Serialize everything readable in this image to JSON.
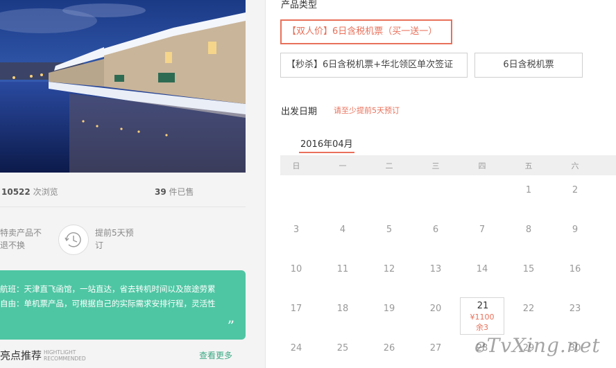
{
  "left": {
    "stats": {
      "views_count": "10522",
      "views_label": "次浏览",
      "sold_count": "39",
      "sold_label": "件已售"
    },
    "features": [
      {
        "line1": "特卖产品不",
        "line2": "退不换"
      },
      {
        "line1": "提前5天预",
        "line2": "订"
      }
    ],
    "highlight": {
      "line1": "航班：天津直飞函馆，一站直达，省去转机时间以及旅途劳累",
      "line2": "自由：单机票产品，可根据自己的实际需求安排行程，灵活性",
      "quote": "”"
    },
    "recommend": {
      "title": "亮点推荐",
      "en_line1": "HIGHTLIGHT",
      "en_line2": "RECOMMENDED",
      "more": "查看更多"
    }
  },
  "right": {
    "product_type_title": "产品类型",
    "options": [
      {
        "label": "【双人价】6日含税机票（买一送一）",
        "selected": true
      },
      {
        "label": "【秒杀】6日含税机票+华北领区单次签证",
        "selected": false
      },
      {
        "label": "6日含税机票",
        "selected": false
      }
    ],
    "date_title": "出发日期",
    "date_hint": "请至少提前5天预订",
    "month": "2016年04月",
    "weekdays": [
      "日",
      "一",
      "二",
      "三",
      "四",
      "五",
      "六"
    ],
    "weeks": [
      [
        "",
        "",
        "",
        "",
        "",
        "1",
        "2"
      ],
      [
        "3",
        "4",
        "5",
        "6",
        "7",
        "8",
        "9"
      ],
      [
        "10",
        "11",
        "12",
        "13",
        "14",
        "15",
        "16"
      ],
      [
        "17",
        "18",
        "19",
        "20",
        "21",
        "22",
        "23"
      ],
      [
        "24",
        "25",
        "26",
        "27",
        "28",
        "29",
        "30"
      ]
    ],
    "available_day": {
      "day": "21",
      "price": "¥1100",
      "stock": "余3"
    }
  },
  "watermark": "eTvXing.net",
  "colors": {
    "accent": "#e8705a",
    "green": "#4fc6a3"
  }
}
